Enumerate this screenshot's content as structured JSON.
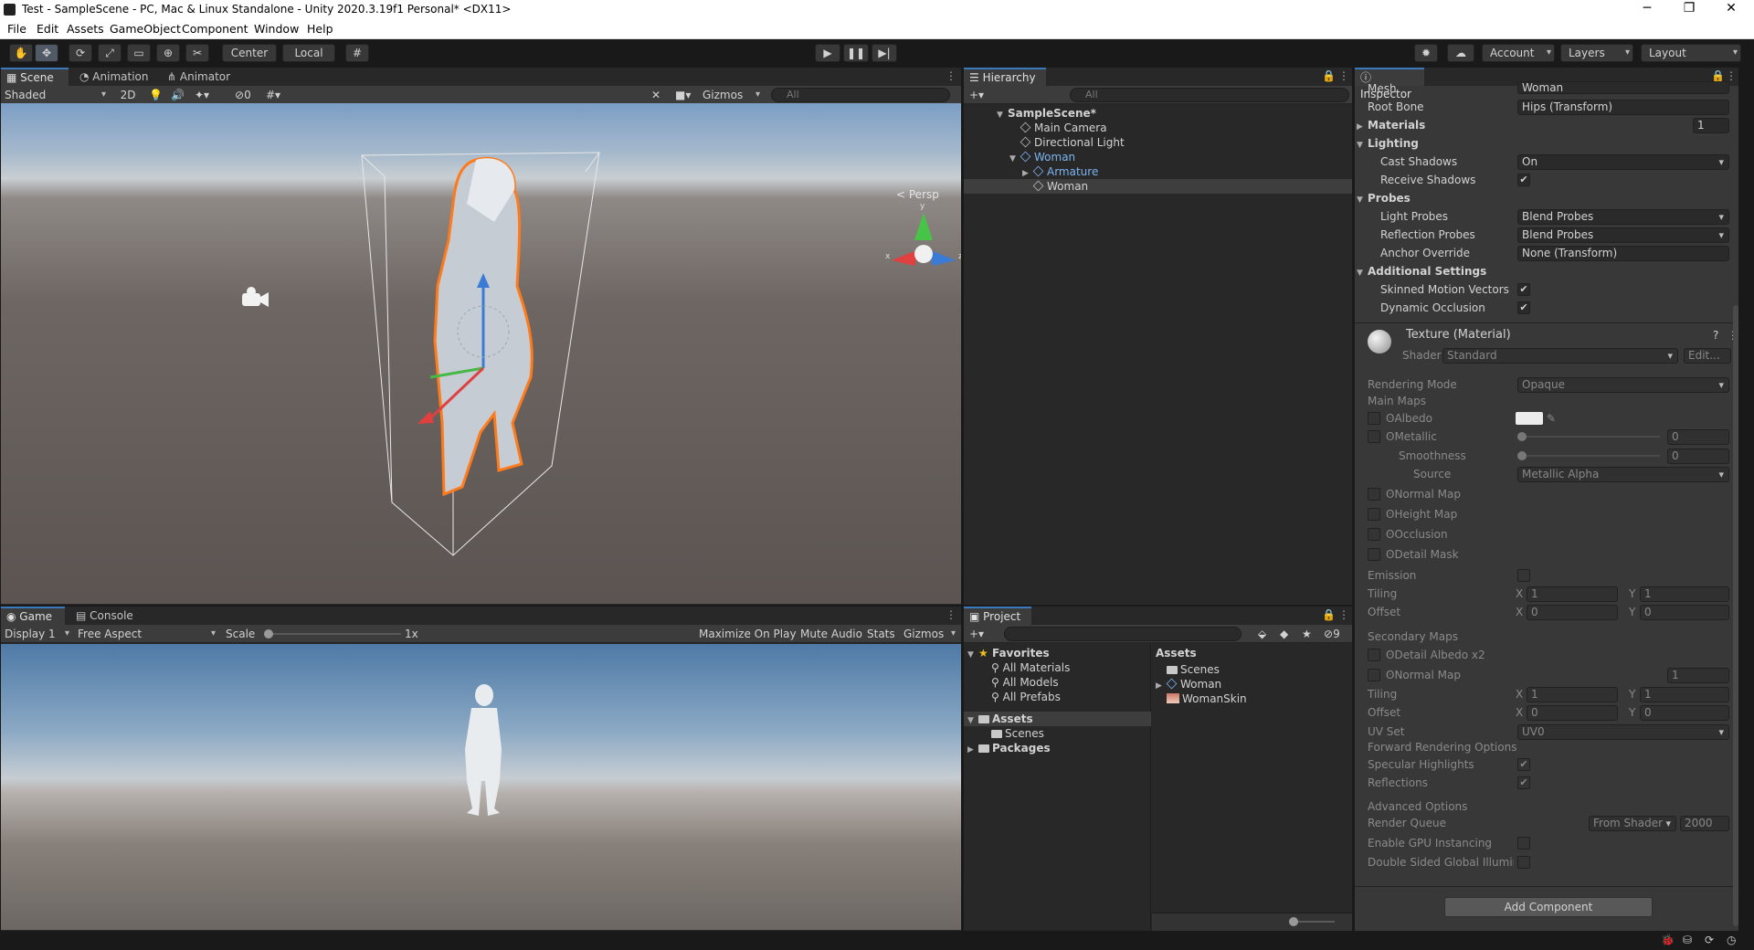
{
  "window": {
    "title": "Test - SampleScene - PC, Mac & Linux Standalone - Unity 2020.3.19f1 Personal* <DX11>",
    "minimize": "─",
    "restore": "❐",
    "close": "✕"
  },
  "menu": [
    "File",
    "Edit",
    "Assets",
    "GameObject",
    "Component",
    "Window",
    "Help"
  ],
  "toolbar": {
    "pivot": "Center",
    "space": "Local",
    "account": "Account",
    "layers": "Layers",
    "layout": "Layout"
  },
  "scene": {
    "tabs": [
      "Scene",
      "Animation",
      "Animator"
    ],
    "shading": "Shaded",
    "mode2d": "2D",
    "hidden_count": "0",
    "gizmos": "Gizmos",
    "search_placeholder": "All",
    "persp": "Persp"
  },
  "game": {
    "tabs": [
      "Game",
      "Console"
    ],
    "display": "Display 1",
    "aspect": "Free Aspect",
    "scale_label": "Scale",
    "scale_value": "1x",
    "maximize": "Maximize On Play",
    "mute": "Mute Audio",
    "stats": "Stats",
    "gizmos": "Gizmos"
  },
  "hierarchy": {
    "tab": "Hierarchy",
    "search_placeholder": "All",
    "items": [
      {
        "label": "SampleScene*",
        "indent": 0
      },
      {
        "label": "Main Camera",
        "indent": 1
      },
      {
        "label": "Directional Light",
        "indent": 1
      },
      {
        "label": "Woman",
        "indent": 1
      },
      {
        "label": "Armature",
        "indent": 2
      },
      {
        "label": "Woman",
        "indent": 2
      }
    ]
  },
  "project": {
    "tab": "Project",
    "count": "9",
    "tree": [
      {
        "label": "Favorites",
        "bold": true
      },
      {
        "label": "All Materials"
      },
      {
        "label": "All Models"
      },
      {
        "label": "All Prefabs"
      },
      {
        "label": "Assets",
        "bold": true
      },
      {
        "label": "Scenes"
      },
      {
        "label": "Packages",
        "bold": true
      }
    ],
    "assets_header": "Assets",
    "assets": [
      "Scenes",
      "Woman",
      "WomanSkin"
    ]
  },
  "inspector": {
    "tab": "Inspector",
    "mesh_label": "Mesh",
    "mesh_value": "Woman",
    "root_bone_label": "Root Bone",
    "root_bone_value": "Hips (Transform)",
    "materials_label": "Materials",
    "materials_count": "1",
    "lighting": "Lighting",
    "cast_shadows": "Cast Shadows",
    "cast_shadows_value": "On",
    "receive_shadows": "Receive Shadows",
    "probes": "Probes",
    "light_probes": "Light Probes",
    "light_probes_value": "Blend Probes",
    "reflection_probes": "Reflection Probes",
    "reflection_probes_value": "Blend Probes",
    "anchor_override": "Anchor Override",
    "anchor_override_value": "None (Transform)",
    "additional": "Additional Settings",
    "skinned_motion": "Skinned Motion Vectors",
    "dynamic_occlusion": "Dynamic Occlusion",
    "material_name": "Texture (Material)",
    "shader_label": "Shader",
    "shader_value": "Standard",
    "edit": "Edit...",
    "rendering_mode": "Rendering Mode",
    "rendering_mode_value": "Opaque",
    "main_maps": "Main Maps",
    "albedo": "Albedo",
    "metallic": "Metallic",
    "metallic_value": "0",
    "smoothness": "Smoothness",
    "smoothness_value": "0",
    "source": "Source",
    "source_value": "Metallic Alpha",
    "normal_map": "Normal Map",
    "height_map": "Height Map",
    "occlusion": "Occlusion",
    "detail_mask": "Detail Mask",
    "emission": "Emission",
    "tiling": "Tiling",
    "offset": "Offset",
    "x": "X",
    "y": "Y",
    "one": "1",
    "zero": "0",
    "secondary_maps": "Secondary Maps",
    "detail_albedo": "Detail Albedo x2",
    "normal_map2": "Normal Map",
    "normal_map2_value": "1",
    "uv_set": "UV Set",
    "uv_set_value": "UV0",
    "forward": "Forward Rendering Options",
    "specular": "Specular Highlights",
    "reflections": "Reflections",
    "advanced": "Advanced Options",
    "render_queue": "Render Queue",
    "render_queue_mode": "From Shader",
    "render_queue_value": "2000",
    "gpu_instancing": "Enable GPU Instancing",
    "double_sided": "Double Sided Global Illumina",
    "add_component": "Add Component"
  }
}
